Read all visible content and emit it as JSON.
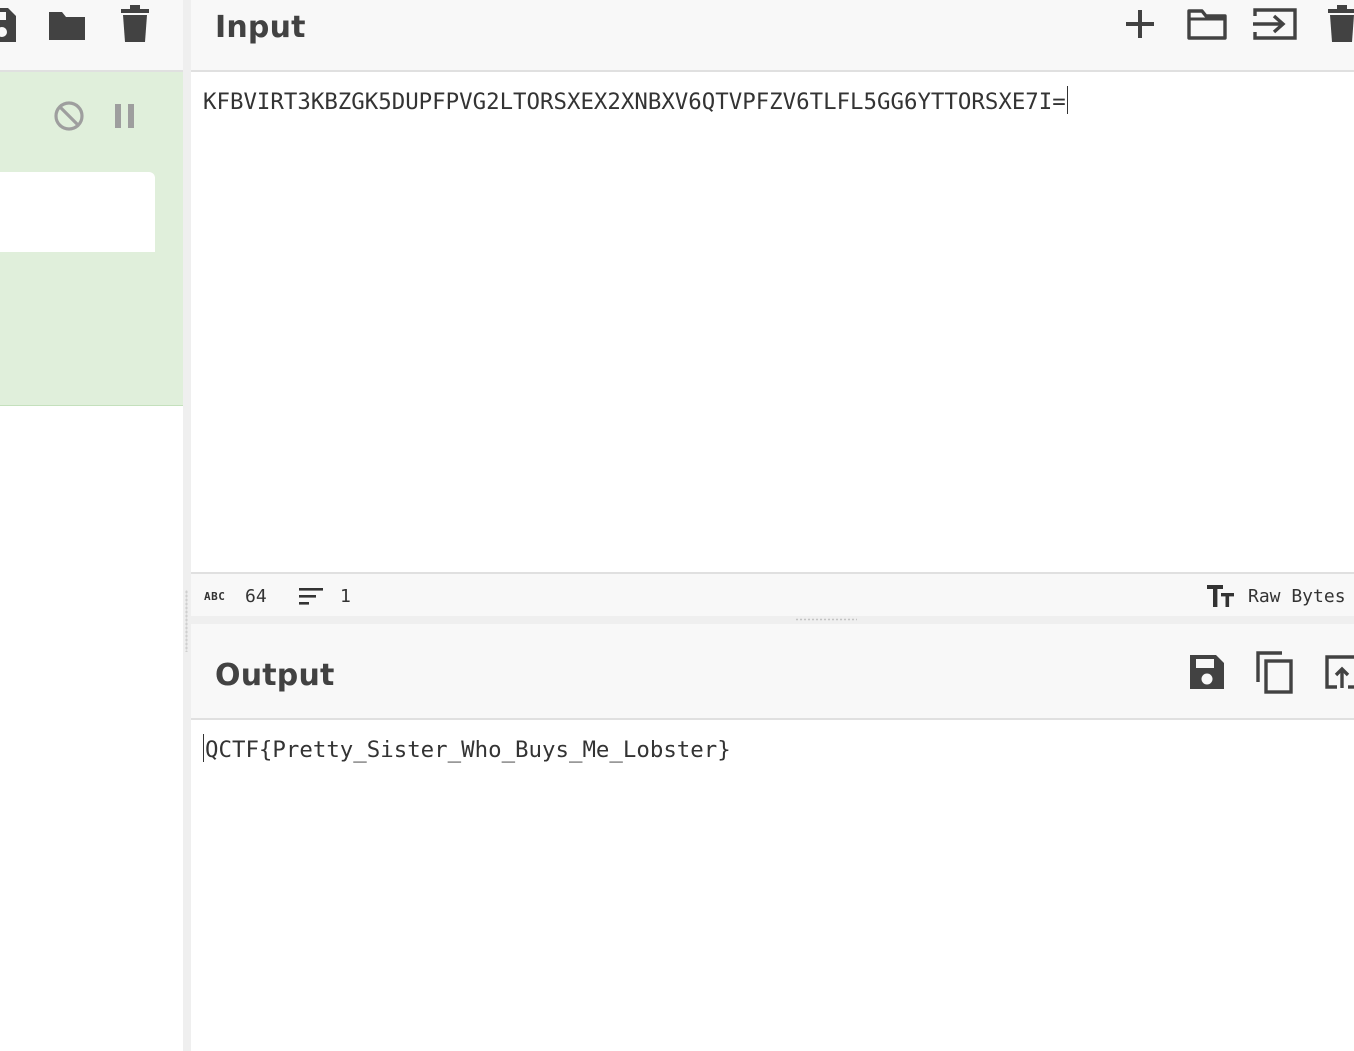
{
  "input": {
    "title": "Input",
    "text": "KFBVIRT3KBZGK5DUPFPVG2LTORSXEX2XNBXV6QTVPFZV6TLFL5GG6YTTORSXE7I=",
    "length": "64",
    "lines": "1",
    "length_icon_label": "ABC",
    "encoding_label": "Raw Bytes"
  },
  "output": {
    "title": "Output",
    "text": "QCTF{Pretty_Sister_Who_Buys_Me_Lobster}"
  },
  "icons": {
    "recipe_toolbar": [
      "save-icon",
      "folder-icon",
      "trash-icon"
    ],
    "recipe_operation": [
      "disable-icon",
      "pause-icon"
    ],
    "input_toolbar": [
      "plus-icon",
      "folder-open-icon",
      "import-icon",
      "trash-icon"
    ],
    "input_status": [
      "length-icon",
      "lines-icon",
      "text-format-icon"
    ],
    "output_toolbar": [
      "save-icon",
      "copy-icon",
      "replace-input-icon"
    ]
  },
  "colors": {
    "header_bg": "#f8f8f8",
    "operation_bg": "#e0efdb",
    "icon": "#424242",
    "disabled_icon": "#9e9e9e"
  }
}
